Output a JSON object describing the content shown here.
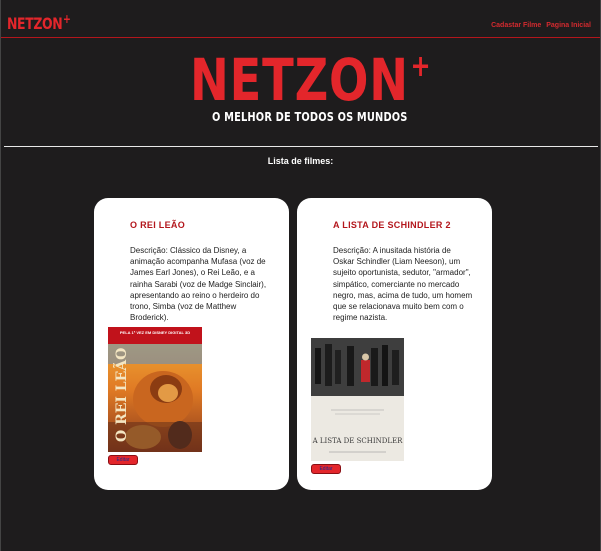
{
  "header": {
    "logo_text": "NETZON",
    "logo_plus": "+",
    "nav": [
      "Cadastar Filme",
      "Pagina Inicial"
    ]
  },
  "hero": {
    "logo_text": "NETZON",
    "logo_plus": "+",
    "tagline": "O MELHOR DE TODOS OS MUNDOS"
  },
  "list_title": "Lista de filmes:",
  "movies": [
    {
      "title": "O REI LEÃO",
      "description": "Descrição: Clássico da Disney, a animação acompanha Mufasa (voz de James Earl Jones), o Rei Leão, e a rainha Sarabi (voz de Madge Sinclair), apresentando ao reino o herdeiro do trono, Simba (voz de Matthew Broderick).",
      "poster_text": "O REI LEÃO",
      "poster_banner": "PELA 1ª VEZ EM DISNEY DIGITAL 3D",
      "button_label": "Editar"
    },
    {
      "title": "A LISTA DE SCHINDLER 2",
      "description": "Descrição: A inusitada história de Oskar Schindler (Liam Neeson), um sujeito oportunista, sedutor, \"armador\", simpático, comerciante no mercado negro, mas, acima de tudo, um homem que se relacionava muito bem com o regime nazista.",
      "poster_text": "A LISTA DE SCHINDLER",
      "button_label": "Editar"
    }
  ],
  "colors": {
    "background": "#1e1c1d",
    "accent": "#e3262b",
    "card": "#ffffff"
  }
}
